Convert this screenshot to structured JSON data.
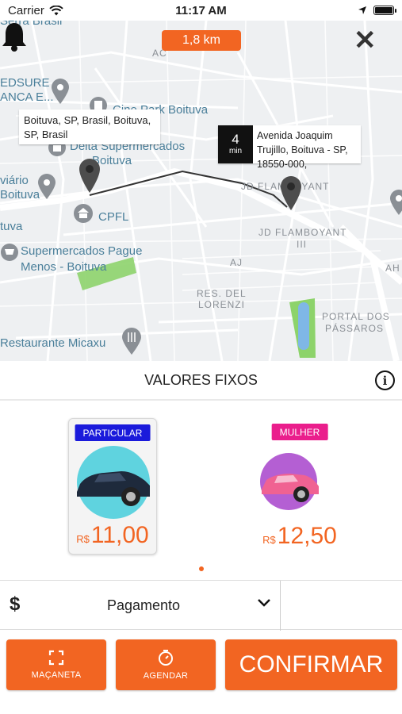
{
  "status_bar": {
    "carrier": "Carrier",
    "time": "11:17 AM"
  },
  "map": {
    "distance": "1,8 km",
    "origin_callout": "Boituva, SP, Brasil, Boituva, SP, Brasil",
    "eta_value": "4",
    "eta_unit": "min",
    "destination_callout": "Avenida Joaquim Trujillo, Boituva - SP, 18550-000,",
    "labels": {
      "l1": "Serra Brasil",
      "l2": "EDSURE",
      "l3": "ANCA E...",
      "l4": "Cine Park Boituva",
      "l5": "Delta Supermercados",
      "l6": "Boituva",
      "l7": "viário",
      "l8": "Boituva",
      "l9": "CPFL",
      "l10": "tuva",
      "l11": "Supermercados Pague",
      "l12": "Menos - Boituva",
      "l13": "Restaurante Micaxu",
      "l14": "JD FLAMBOYANT",
      "l15": "JD FLAMBOYANT",
      "l16": "III",
      "l17": "AJ",
      "l18": "RES. DEL",
      "l19": "LORENZI",
      "l20": "PORTAL DOS",
      "l21": "PÁSSAROS",
      "l22": "AH",
      "l23": "AC"
    }
  },
  "panel": {
    "title": "VALORES FIXOS"
  },
  "options": [
    {
      "tag": "PARTICULAR",
      "currency": "R$",
      "price": "11,00",
      "tag_color": "#1a1adb"
    },
    {
      "tag": "MULHER",
      "currency": "R$",
      "price": "12,50",
      "tag_color": "#ea1e8c"
    }
  ],
  "payment": {
    "icon": "$",
    "label": "Pagamento"
  },
  "buttons": {
    "handle": "MAÇANETA",
    "schedule": "AGENDAR",
    "confirm": "CONFIRMAR"
  },
  "colors": {
    "accent": "#f26522"
  }
}
